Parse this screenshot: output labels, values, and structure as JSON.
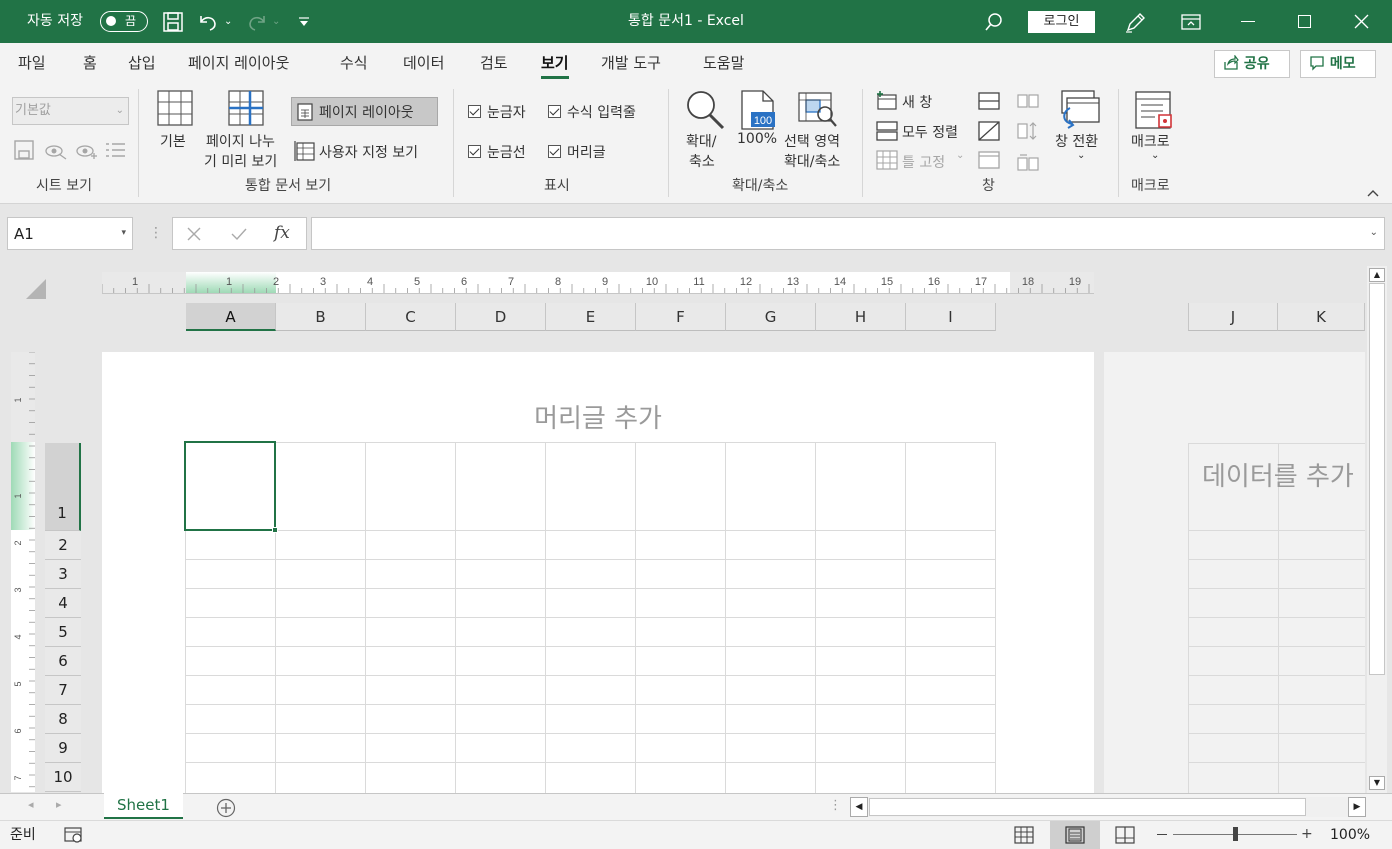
{
  "titlebar": {
    "autosave_label": "자동 저장",
    "autosave_state": "끔",
    "doc_title": "통합 문서1  -  Excel",
    "login_label": "로그인"
  },
  "tabs": [
    {
      "label": "파일"
    },
    {
      "label": "홈"
    },
    {
      "label": "삽입"
    },
    {
      "label": "페이지 레이아웃"
    },
    {
      "label": "수식"
    },
    {
      "label": "데이터"
    },
    {
      "label": "검토"
    },
    {
      "label": "보기"
    },
    {
      "label": "개발 도구"
    },
    {
      "label": "도움말"
    }
  ],
  "active_tab": "보기",
  "share_label": "공유",
  "memo_label": "메모",
  "ribbon": {
    "sheet_view": {
      "dropdown_value": "기본값",
      "group": "시트 보기"
    },
    "workbook_views": {
      "normal": "기본",
      "page_break_1": "페이지 나누",
      "page_break_2": "기 미리 보기",
      "page_layout": "페이지 레이아웃",
      "custom": "사용자 지정 보기",
      "group": "통합 문서 보기"
    },
    "show": {
      "ruler": "눈금자",
      "formula_bar": "수식 입력줄",
      "gridlines": "눈금선",
      "headings": "머리글",
      "group": "표시"
    },
    "zoom": {
      "zoom_1": "확대/",
      "zoom_2": "축소",
      "hundred": "100%",
      "sel_1": "선택 영역",
      "sel_2": "확대/축소",
      "group": "확대/축소"
    },
    "window": {
      "new": "새 창",
      "arrange": "모두 정렬",
      "freeze": "틀 고정",
      "switch": "창 전환",
      "group": "창"
    },
    "macros": {
      "label": "매크로",
      "group": "매크로"
    }
  },
  "formula": {
    "name_box": "A1",
    "fx": "fx",
    "value": ""
  },
  "ruler": [
    "1",
    "1",
    "2",
    "3",
    "4",
    "5",
    "6",
    "7",
    "8",
    "9",
    "10",
    "11",
    "12",
    "13",
    "14",
    "15",
    "16",
    "17",
    "18",
    "19"
  ],
  "columns": [
    "A",
    "B",
    "C",
    "D",
    "E",
    "F",
    "G",
    "H",
    "I"
  ],
  "columns2": [
    "J",
    "K"
  ],
  "rows": [
    "1",
    "2",
    "3",
    "4",
    "5",
    "6",
    "7",
    "8",
    "9",
    "10"
  ],
  "vruler": [
    "1",
    "1",
    "2",
    "3",
    "4",
    "5",
    "6",
    "7"
  ],
  "page": {
    "header_placeholder": "머리글 추가",
    "add_data": "데이터를 추가"
  },
  "sheet_tab": "Sheet1",
  "status": {
    "ready": "준비",
    "zoom": "100%"
  }
}
